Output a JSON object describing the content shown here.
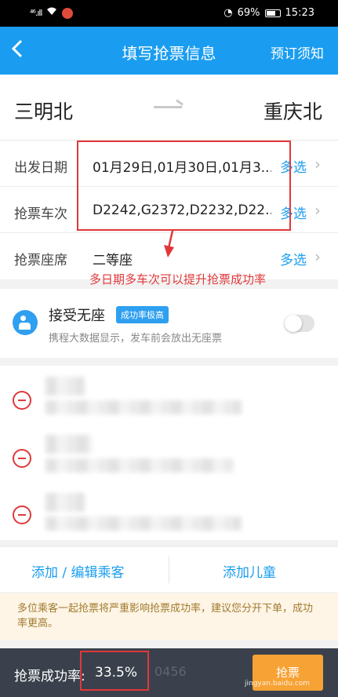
{
  "status_bar": {
    "signal": "⁴⁶.ıll",
    "battery": "69%",
    "time": "15:23"
  },
  "header": {
    "back_icon": "chevron-left-icon",
    "title": "填写抢票信息",
    "notice": "预订须知"
  },
  "route": {
    "from": "三明北",
    "to": "重庆北"
  },
  "form": {
    "rows": [
      {
        "label": "出发日期",
        "value": "01月29日,01月30日,01月3...",
        "action": "多选"
      },
      {
        "label": "抢票车次",
        "value": "D2242,G2372,D2232,D22...",
        "action": "多选"
      },
      {
        "label": "抢票座席",
        "value": "二等座",
        "action": "多选"
      }
    ]
  },
  "annotation": {
    "text": "多日期多车次可以提升抢票成功率",
    "color": "#e0383a"
  },
  "no_seat": {
    "title": "接受无座",
    "badge": "成功率极高",
    "description": "携程大数据显示，发车前会放出无座票",
    "enabled": false
  },
  "passenger_actions": {
    "add_edit": "添加 / 编辑乘客",
    "add_child": "添加儿童"
  },
  "warning": "多位乘客一起抢票将严重影响抢票成功率，建议您分开下单，成功率更高。",
  "bottom": {
    "rate_label": "抢票成功率:",
    "rate_value": "33.5%",
    "partial_text": "0456",
    "submit_label": "抢票",
    "watermark": "jingyan.baidu.com"
  },
  "colors": {
    "primary": "#1a9df0",
    "annotation_red": "#e0383a",
    "submit_orange": "#f7a234",
    "bottom_bar": "#3a414c"
  }
}
